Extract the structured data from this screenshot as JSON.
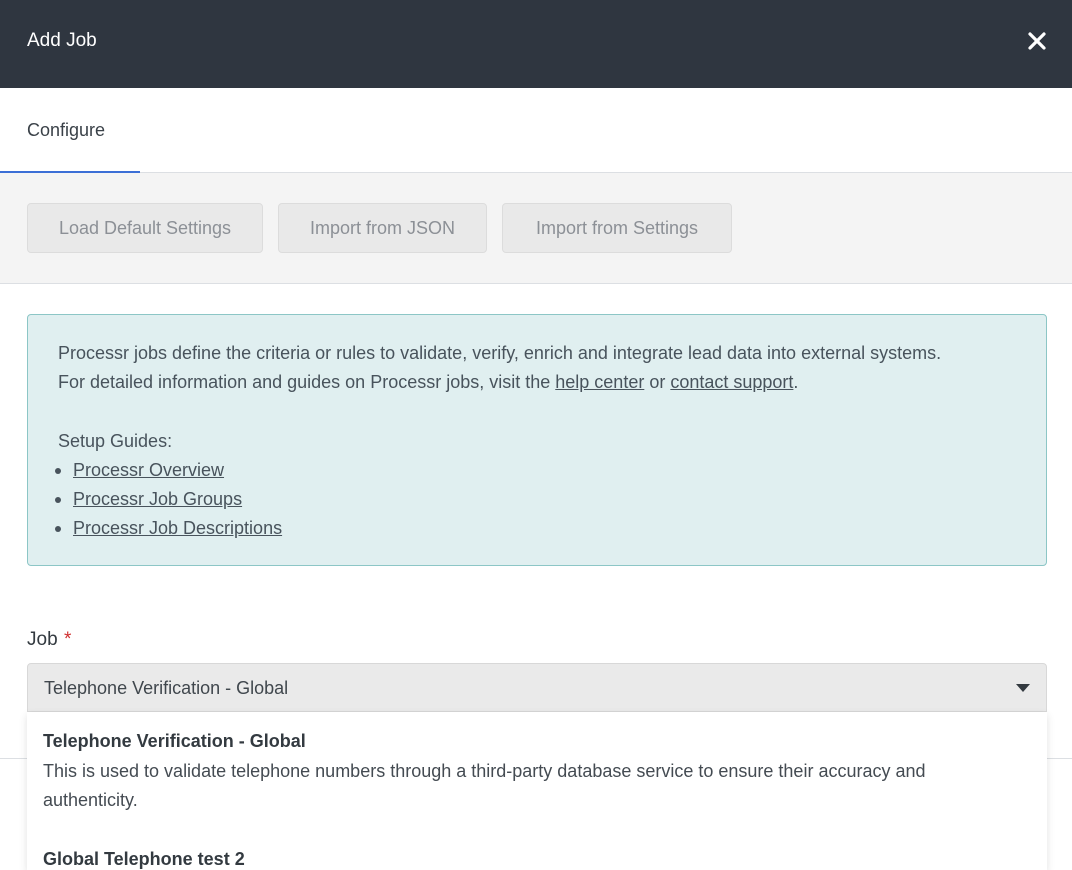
{
  "header": {
    "title": "Add Job",
    "close_icon": "close-icon"
  },
  "tabs": [
    {
      "label": "Configure",
      "active": true
    }
  ],
  "toolbar": {
    "load_default": "Load Default Settings",
    "import_json": "Import from JSON",
    "import_settings": "Import from Settings"
  },
  "info": {
    "line1": "Processr jobs define the criteria or rules to validate, verify, enrich and integrate lead data into external systems.",
    "line2_prefix": "For detailed information and guides on Processr jobs, visit the ",
    "help_center": "help center",
    "line2_or": " or ",
    "contact_support": "contact support",
    "line2_suffix": ".",
    "setup_guides": "Setup Guides:",
    "guides": [
      "Processr Overview",
      "Processr Job Groups",
      "Processr Job Descriptions"
    ]
  },
  "job_field": {
    "label": "Job",
    "required_mark": "*",
    "value": "Telephone Verification - Global"
  },
  "dropdown": {
    "options": [
      {
        "title": "Telephone Verification - Global",
        "description": "This is used to validate telephone numbers through a third-party database service to ensure their accuracy and authenticity."
      },
      {
        "title": "Global Telephone test 2"
      }
    ]
  },
  "colors": {
    "header_bg": "#2f3640",
    "tab_accent": "#3b6fd6",
    "info_bg": "#e0eff0",
    "info_border": "#8cc6c6",
    "required": "#d03030"
  }
}
